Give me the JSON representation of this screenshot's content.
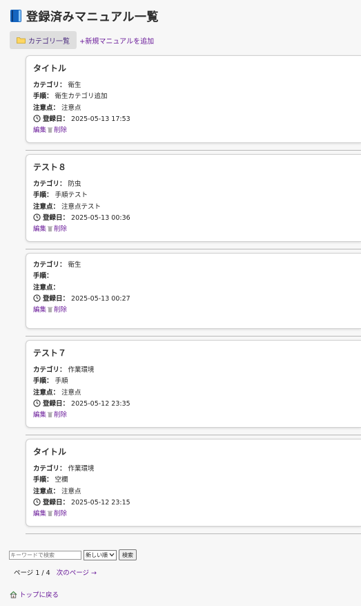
{
  "page": {
    "title": "登録済みマニュアル一覧"
  },
  "actions": {
    "category_list": "カテゴリ一覧",
    "add_manual": "+新規マニュアルを追加"
  },
  "labels": {
    "category": "カテゴリ：",
    "steps": "手順：",
    "notes": "注意点：",
    "registered": "登録日：",
    "edit": "編集",
    "delete": "削除"
  },
  "manuals": [
    {
      "title": "タイトル",
      "category": "衛生",
      "steps": "衛生カテゴリ追加",
      "notes": "注意点",
      "date": "2025-05-13 17:53"
    },
    {
      "title": "テスト８",
      "category": "防虫",
      "steps": "手順テスト",
      "notes": "注意点テスト",
      "date": "2025-05-13 00:36"
    },
    {
      "title": "",
      "category": "衛生",
      "steps": "",
      "notes": "",
      "date": "2025-05-13 00:27"
    },
    {
      "title": "テスト７",
      "category": "作業環境",
      "steps": "手順",
      "notes": "注意点",
      "date": "2025-05-12 23:35"
    },
    {
      "title": "タイトル",
      "category": "作業環境",
      "steps": "空欄",
      "notes": "注意点",
      "date": "2025-05-12 23:15"
    }
  ],
  "search": {
    "placeholder": "キーワードで検索",
    "sort_selected": "新しい順",
    "button": "検索"
  },
  "pagination": {
    "status": "ページ 1 / 4",
    "next": "次のページ →"
  },
  "footer": {
    "home": "トップに戻る"
  }
}
